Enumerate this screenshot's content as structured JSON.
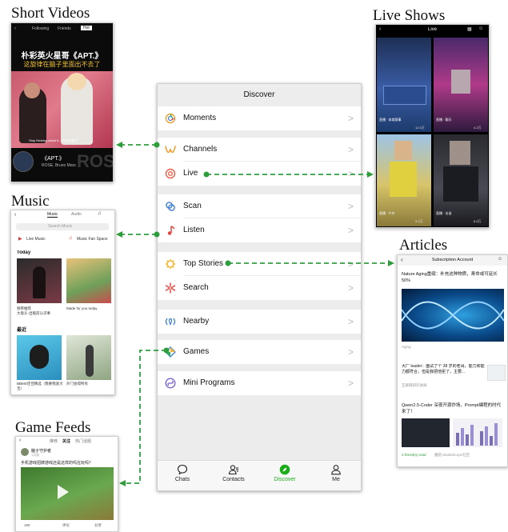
{
  "labels": {
    "short_videos": "Short Videos",
    "music": "Music",
    "game_feeds": "Game Feeds",
    "live_shows": "Live Shows",
    "articles": "Articles"
  },
  "discover": {
    "title": "Discover",
    "items": [
      {
        "label": "Moments",
        "icon": "moments-icon"
      },
      {
        "label": "Channels",
        "icon": "channels-icon"
      },
      {
        "label": "Live",
        "icon": "live-icon"
      },
      {
        "label": "Scan",
        "icon": "scan-icon"
      },
      {
        "label": "Listen",
        "icon": "listen-icon"
      },
      {
        "label": "Top Stories",
        "icon": "top-stories-icon"
      },
      {
        "label": "Search",
        "icon": "search-icon"
      },
      {
        "label": "Nearby",
        "icon": "nearby-icon"
      },
      {
        "label": "Games",
        "icon": "games-icon"
      },
      {
        "label": "Mini Programs",
        "icon": "mini-programs-icon"
      }
    ],
    "chevron": ">",
    "tabs": [
      "Chats",
      "Contacts",
      "Discover",
      "Me"
    ]
  },
  "short_videos": {
    "tabs": [
      "Following",
      "Friends",
      "Hot"
    ],
    "headline": "朴彩英火星哥《APT.》",
    "subline": "这旋律在脑子里面出不去了",
    "caption": "Stop thinking about it... 也太洗脑了",
    "title": "《APT.》",
    "artist": "ROSÉ, Bruno Mars",
    "watermark": "ROSÉ"
  },
  "music": {
    "tabs": [
      "Music",
      "Audio"
    ],
    "search_placeholder": "Search Music",
    "quick": [
      "Live Music",
      "Music Fan Space"
    ],
    "today_label": "Today",
    "cards_today": [
      "频率推荐\n大盘头·出版前认识事",
      "Made for you today"
    ],
    "recent_label": "最近",
    "cards_recent": [
      "BBMS佳佳精选（我要我爱大宝）",
      "外门会得所有"
    ]
  },
  "game_feeds": {
    "tabs": [
      "推荐",
      "关注",
      "热门话题"
    ],
    "author": "脑子守护者",
    "meta": "1天前",
    "text": "手机游戏招牌游戏还是这样的吗在玩吗？",
    "actions": [
      "190",
      "评论",
      "分享"
    ]
  },
  "live": {
    "title": "Live",
    "cards": [
      {
        "caption": "直播 · 体育赛事",
        "count": "12.5万"
      },
      {
        "caption": "直播 · 聊天",
        "count": "4.2万"
      },
      {
        "caption": "直播 · 户外",
        "count": "3.1万"
      },
      {
        "caption": "直播 · 访谈",
        "count": "8.8万"
      }
    ]
  },
  "articles": {
    "header": "Subscription Account",
    "a1_title": "Nature Aging重磅：补充这种物质，寿命或可延长50%",
    "a1_source": "Aging",
    "a2_title": "大厂 leader：面试了个 38 岁的老哥，能力和能力都符合，但是我把他拒了，主要...",
    "a2_source": "互联网研究进展",
    "a3_title": "Qwen2.5-Coder 深夜开源炸场，Prompt编程的时代来了！",
    "a3_meta": "3 friend(s) read",
    "a3_source": "魔搭 ModelScope社区"
  },
  "colors": {
    "wechat_green": "#1aad19",
    "arrow_green": "#2e9e3c"
  }
}
